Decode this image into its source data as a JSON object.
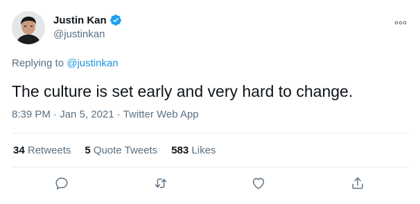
{
  "author": {
    "display_name": "Justin Kan",
    "handle": "@justinkan",
    "verified": true
  },
  "reply": {
    "prefix": "Replying to",
    "mention": "@justinkan"
  },
  "tweet": {
    "text": "The culture is set early and very hard to change.",
    "time": "8:39 PM",
    "date": "Jan 5, 2021",
    "source": "Twitter Web App",
    "separator": "·"
  },
  "stats": {
    "retweets_count": "34",
    "retweets_label": "Retweets",
    "quote_count": "5",
    "quote_label": "Quote Tweets",
    "likes_count": "583",
    "likes_label": "Likes"
  },
  "icons": {
    "more": "more-horizontal-icon",
    "reply": "reply-icon",
    "retweet": "retweet-icon",
    "like": "like-icon",
    "share": "share-icon"
  },
  "colors": {
    "link": "#1b95e0",
    "secondary_text": "#5b7083",
    "verified_badge": "#1da1f2",
    "divider": "#e6ecf0"
  }
}
